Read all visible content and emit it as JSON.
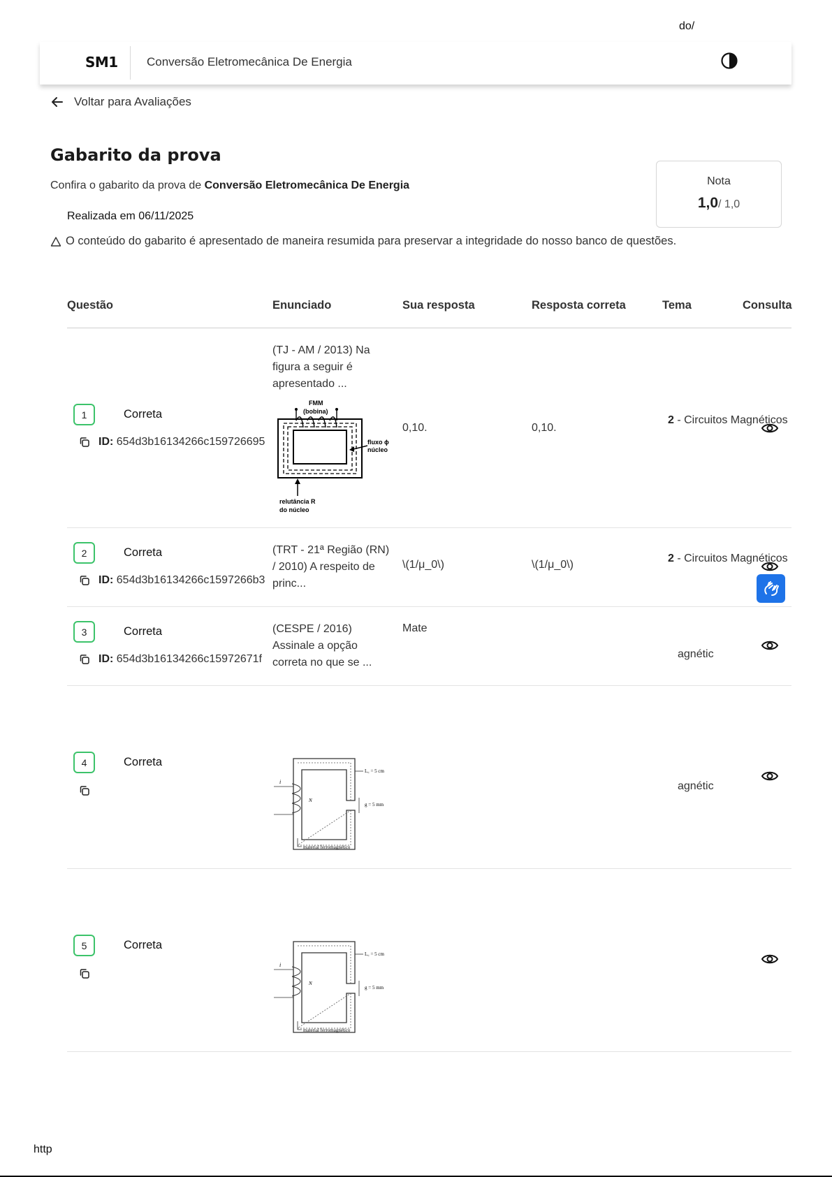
{
  "browser": {
    "top_text": "do/",
    "footer_url": "http"
  },
  "header": {
    "logo": "SM1",
    "course": "Conversão Eletromecânica De Energia"
  },
  "back": {
    "label": "Voltar para Avaliações"
  },
  "page": {
    "title": "Gabarito da prova",
    "subtitle_prefix": "Confira o gabarito da prova de ",
    "subtitle_course": "Conversão Eletromecânica De Energia",
    "date": "Realizada em 06/11/2025",
    "notice": "O conteúdo do gabarito é apresentado de maneira resumida para preservar a integridade do nosso banco de questões."
  },
  "grade": {
    "label": "Nota",
    "value": "1,0",
    "max": "/ 1,0"
  },
  "table": {
    "headers": [
      "Questão",
      "Enunciado",
      "Sua resposta",
      "Resposta correta",
      "Tema",
      "Consulta"
    ],
    "rows": [
      {
        "number": "1",
        "status": "Correta",
        "id_label": "ID:",
        "id": "654d3b16134266c159726695",
        "statement": "(TJ - AM / 2013) Na figura a seguir é apresentado ...",
        "answer": "0,10.",
        "correct": "0,10.",
        "theme_num": "2",
        "theme": " - Circuitos Magnéticos",
        "figure_labels": {
          "fmm": "FMM",
          "bobina": "(bobina)",
          "fluxo": "fluxo ϕ",
          "nucleo": "núcleo",
          "relutancia": "relutância R",
          "do_nucleo": "do núcleo"
        }
      },
      {
        "number": "2",
        "status": "Correta",
        "id_label": "ID:",
        "id": "654d3b16134266c1597266b3",
        "statement": "(TRT - 21ª Região (RN) / 2010) A respeito de princ...",
        "answer": "\\(1/μ_0\\)",
        "correct": "\\(1/μ_0\\)",
        "theme_num": "2",
        "theme": " - Circuitos Magnéticos"
      },
      {
        "number": "3",
        "status": "Correta",
        "id_label": "ID:",
        "id": "654d3b16134266c15972671f",
        "statement": "(CESPE / 2016) Assinale a opção correta no que se ...",
        "answer": "Mate",
        "theme": "agnétic"
      },
      {
        "number": "4",
        "status": "Correta",
        "theme": "agnétic",
        "figure_labels": {
          "lc": "L꜀ = 5 cm",
          "g": "g = 5 mm",
          "n": "N",
          "i": "i",
          "material": "material ferromagnético"
        }
      },
      {
        "number": "5",
        "status": "Correta",
        "figure_labels": {
          "lc": "L꜀ = 5 cm",
          "g": "g = 5 mm",
          "n": "N",
          "i": "i",
          "material": "material ferromagnético"
        }
      }
    ]
  },
  "icons": {
    "back": "arrow-left-icon",
    "contrast": "contrast-icon",
    "copy": "copy-icon",
    "view": "eye-icon",
    "warning": "warning-triangle-icon",
    "a11y": "sign-language-icon"
  },
  "colors": {
    "correct_border": "#3cc36a",
    "a11y_button": "#1e73e8"
  }
}
